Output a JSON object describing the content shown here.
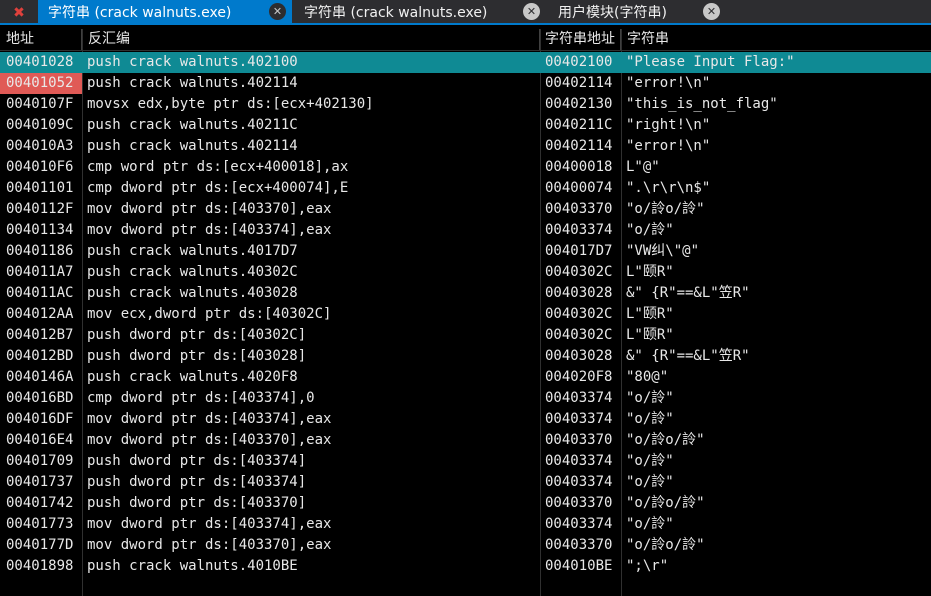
{
  "tabs": [
    {
      "label": "字符串 (crack walnuts.exe)"
    },
    {
      "label": "字符串 (crack walnuts.exe)"
    },
    {
      "label": "用户模块(字符串)"
    }
  ],
  "colors": {
    "accent": "#007acc",
    "selection": "#0f8a94",
    "breakpoint": "#e05a56",
    "close_all": "#e0413c"
  },
  "columns": {
    "address": "地址",
    "disasm": "反汇编",
    "str_addr": "字符串地址",
    "string": "字符串"
  },
  "rows": [
    {
      "addr": "00401028",
      "disasm": "push crack walnuts.402100",
      "saddr": "00402100",
      "str": "\"Please Input Flag:\""
    },
    {
      "addr": "00401052",
      "disasm": "push crack walnuts.402114",
      "saddr": "00402114",
      "str": "\"error!\\n\""
    },
    {
      "addr": "0040107F",
      "disasm": "movsx edx,byte ptr ds:[ecx+402130]",
      "saddr": "00402130",
      "str": "\"this_is_not_flag\""
    },
    {
      "addr": "0040109C",
      "disasm": "push crack walnuts.40211C",
      "saddr": "0040211C",
      "str": "\"right!\\n\""
    },
    {
      "addr": "004010A3",
      "disasm": "push crack walnuts.402114",
      "saddr": "00402114",
      "str": "\"error!\\n\""
    },
    {
      "addr": "004010F6",
      "disasm": "cmp word ptr ds:[ecx+400018],ax",
      "saddr": "00400018",
      "str": "L\"@\""
    },
    {
      "addr": "00401101",
      "disasm": "cmp dword ptr ds:[ecx+400074],E",
      "saddr": "00400074",
      "str": "\".\\r\\r\\n$\""
    },
    {
      "addr": "0040112F",
      "disasm": "mov dword ptr ds:[403370],eax",
      "saddr": "00403370",
      "str": "\"o/詅o/詅\""
    },
    {
      "addr": "00401134",
      "disasm": "mov dword ptr ds:[403374],eax",
      "saddr": "00403374",
      "str": "\"o/詅\""
    },
    {
      "addr": "00401186",
      "disasm": "push crack walnuts.4017D7",
      "saddr": "004017D7",
      "str": "\"VW纠\\\"@\""
    },
    {
      "addr": "004011A7",
      "disasm": "push crack walnuts.40302C",
      "saddr": "0040302C",
      "str": "L\"颐R\""
    },
    {
      "addr": "004011AC",
      "disasm": "push crack walnuts.403028",
      "saddr": "00403028",
      "str": "&\" {R\"==&L\"笠R\""
    },
    {
      "addr": "004012AA",
      "disasm": "mov ecx,dword ptr ds:[40302C]",
      "saddr": "0040302C",
      "str": "L\"颐R\""
    },
    {
      "addr": "004012B7",
      "disasm": "push dword ptr ds:[40302C]",
      "saddr": "0040302C",
      "str": "L\"颐R\""
    },
    {
      "addr": "004012BD",
      "disasm": "push dword ptr ds:[403028]",
      "saddr": "00403028",
      "str": "&\" {R\"==&L\"笠R\""
    },
    {
      "addr": "0040146A",
      "disasm": "push crack walnuts.4020F8",
      "saddr": "004020F8",
      "str": "\"80@\""
    },
    {
      "addr": "004016BD",
      "disasm": "cmp dword ptr ds:[403374],0",
      "saddr": "00403374",
      "str": "\"o/詅\""
    },
    {
      "addr": "004016DF",
      "disasm": "mov dword ptr ds:[403374],eax",
      "saddr": "00403374",
      "str": "\"o/詅\""
    },
    {
      "addr": "004016E4",
      "disasm": "mov dword ptr ds:[403370],eax",
      "saddr": "00403370",
      "str": "\"o/詅o/詅\""
    },
    {
      "addr": "00401709",
      "disasm": "push dword ptr ds:[403374]",
      "saddr": "00403374",
      "str": "\"o/詅\""
    },
    {
      "addr": "00401737",
      "disasm": "push dword ptr ds:[403374]",
      "saddr": "00403374",
      "str": "\"o/詅\""
    },
    {
      "addr": "00401742",
      "disasm": "push dword ptr ds:[403370]",
      "saddr": "00403370",
      "str": "\"o/詅o/詅\""
    },
    {
      "addr": "00401773",
      "disasm": "mov dword ptr ds:[403374],eax",
      "saddr": "00403374",
      "str": "\"o/詅\""
    },
    {
      "addr": "0040177D",
      "disasm": "mov dword ptr ds:[403370],eax",
      "saddr": "00403370",
      "str": "\"o/詅o/詅\""
    },
    {
      "addr": "00401898",
      "disasm": "push crack walnuts.4010BE",
      "saddr": "004010BE",
      "str": "\";\\r\""
    }
  ]
}
